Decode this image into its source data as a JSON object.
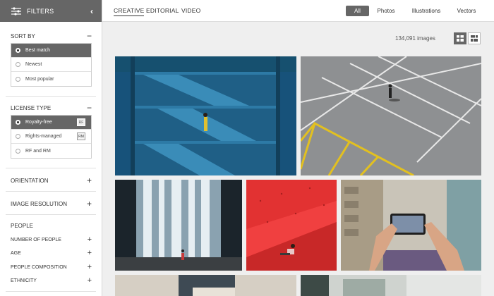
{
  "sidebar": {
    "title": "FILTERS",
    "sort": {
      "heading": "SORT BY",
      "options": [
        "Best match",
        "Newest",
        "Most popular"
      ],
      "selected_index": 0
    },
    "license": {
      "heading": "LICENSE TYPE",
      "options": [
        {
          "label": "Royalty-free",
          "badge": "RF"
        },
        {
          "label": "Rights-managed",
          "badge": "RM"
        },
        {
          "label": "RF and RM",
          "badge": ""
        }
      ],
      "selected_index": 0
    },
    "orientation": "ORIENTATION",
    "resolution": "IMAGE RESOLUTION",
    "people": {
      "heading": "PEOPLE",
      "subs": [
        "NUMBER OF PEOPLE",
        "AGE",
        "PEOPLE COMPOSITION",
        "ETHNICITY"
      ]
    }
  },
  "nav": {
    "tabs": [
      "CREATIVE",
      "EDITORIAL",
      "VIDEO"
    ],
    "active_tab": 0,
    "filters": [
      "All",
      "Photos",
      "Illustrations",
      "Vectors"
    ],
    "active_filter": 0
  },
  "results": {
    "count": "134,091 images"
  },
  "colors": {
    "accent_gray": "#666666",
    "background": "#efefef"
  }
}
